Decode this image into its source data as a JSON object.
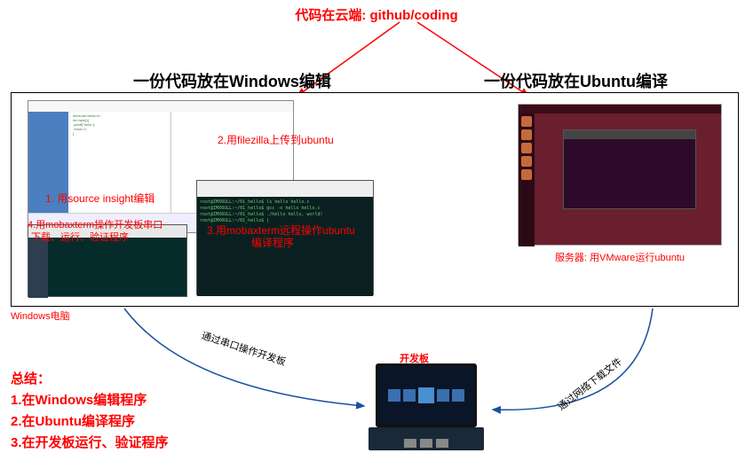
{
  "cloud": {
    "label": "代码在云端: github/coding"
  },
  "headings": {
    "left": "一份代码放在Windows编辑",
    "right": "一份代码放在Ubuntu编译"
  },
  "annotations": {
    "source_insight": "1. 用source insight编辑",
    "filezilla": "2.用filezilla上传到ubuntu",
    "moba_remote": "3.用mobaxterm远程操作ubuntu",
    "moba_remote_line2": "编译程序",
    "moba_serial": "4.用mobaxterm操作开发板串口",
    "moba_serial_line2": "下载、运行、验证程序",
    "ubuntu_caption": "服务器: 用VMware运行ubuntu",
    "windows_label": "Windows电脑",
    "devboard_label": "开发板",
    "path_left": "通过串口操作开发板",
    "path_right": "通过网络下载文件"
  },
  "terminal": {
    "lines": "root@IMX6ULL:~/01_hello$ ls\nhello hello.c\nroot@IMX6ULL:~/01_hello$ gcc -o hello hello.c\nroot@IMX6ULL:~/01_hello$ ./hello\nhello, world!\nroot@IMX6ULL:~/01_hello$ |"
  },
  "summary": {
    "title": "总结：",
    "line1": "1.在Windows编辑程序",
    "line2": "2.在Ubuntu编译程序",
    "line3": "3.在开发板运行、验证程序"
  }
}
